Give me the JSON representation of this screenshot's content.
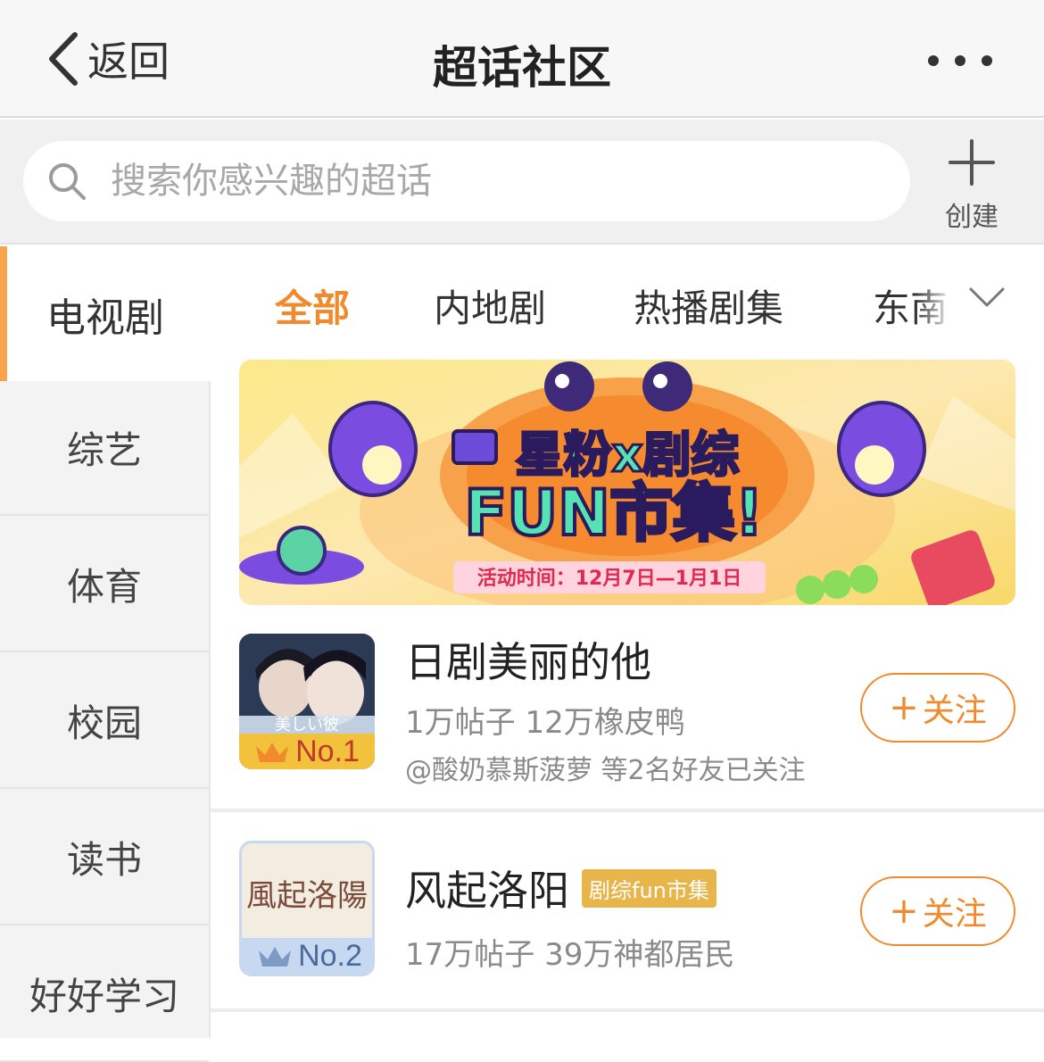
{
  "nav": {
    "back_label": "返回",
    "title": "超话社区"
  },
  "search": {
    "placeholder": "搜索你感兴趣的超话",
    "create_label": "创建"
  },
  "sidebar": {
    "items": [
      {
        "label": "电视剧",
        "active": true
      },
      {
        "label": "综艺"
      },
      {
        "label": "体育"
      },
      {
        "label": "校园"
      },
      {
        "label": "读书"
      },
      {
        "label": "好好学习"
      }
    ]
  },
  "tabs": {
    "items": [
      {
        "label": "全部",
        "active": true
      },
      {
        "label": "内地剧"
      },
      {
        "label": "热播剧集"
      },
      {
        "label": "东南"
      }
    ]
  },
  "banner": {
    "line1": "星粉x剧综",
    "line2": "FUN市集!",
    "date": "活动时间：12月7日—1月1日"
  },
  "list": [
    {
      "title": "日剧美丽的他",
      "rank": "No.1",
      "stats": "1万帖子 12万橡皮鸭",
      "friends": "@酸奶慕斯菠萝 等2名好友已关注",
      "follow_label": "关注",
      "cover_text": "美しい彼"
    },
    {
      "title": "风起洛阳",
      "tag": "剧综fun市集",
      "rank": "No.2",
      "stats": "17万帖子 39万神都居民",
      "follow_label": "关注",
      "cover_text": "風起洛陽"
    }
  ],
  "colors": {
    "accent": "#f08a2d",
    "sidebar_indicator": "#f7a44c",
    "rank1_badge": "#f2c23c",
    "rank2_badge": "#c7d9f0"
  }
}
